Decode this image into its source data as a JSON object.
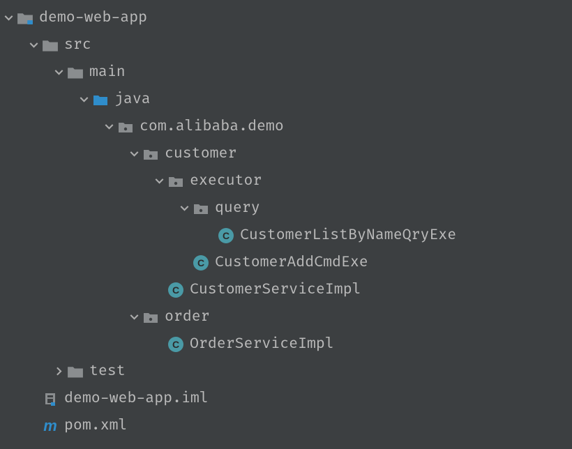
{
  "tree": {
    "root": {
      "label": "demo-web-app",
      "src": {
        "label": "src",
        "main": {
          "label": "main",
          "java": {
            "label": "java",
            "pkg_root": {
              "label": "com.alibaba.demo",
              "customer": {
                "label": "customer",
                "executor": {
                  "label": "executor",
                  "query": {
                    "label": "query",
                    "cls0": {
                      "label": "CustomerListByNameQryExe"
                    }
                  },
                  "cls0": {
                    "label": "CustomerAddCmdExe"
                  }
                },
                "cls0": {
                  "label": "CustomerServiceImpl"
                }
              },
              "order": {
                "label": "order",
                "cls0": {
                  "label": "OrderServiceImpl"
                }
              }
            }
          }
        },
        "test": {
          "label": "test"
        }
      },
      "iml": {
        "label": "demo-web-app.iml"
      },
      "pom": {
        "label": "pom.xml"
      }
    }
  },
  "colors": {
    "bg": "#3c3f41",
    "text": "#bbbbbb",
    "folder_grey": "#8a8d8f",
    "source_blue": "#2f8dcb",
    "class_badge": "#4a9aa6"
  }
}
